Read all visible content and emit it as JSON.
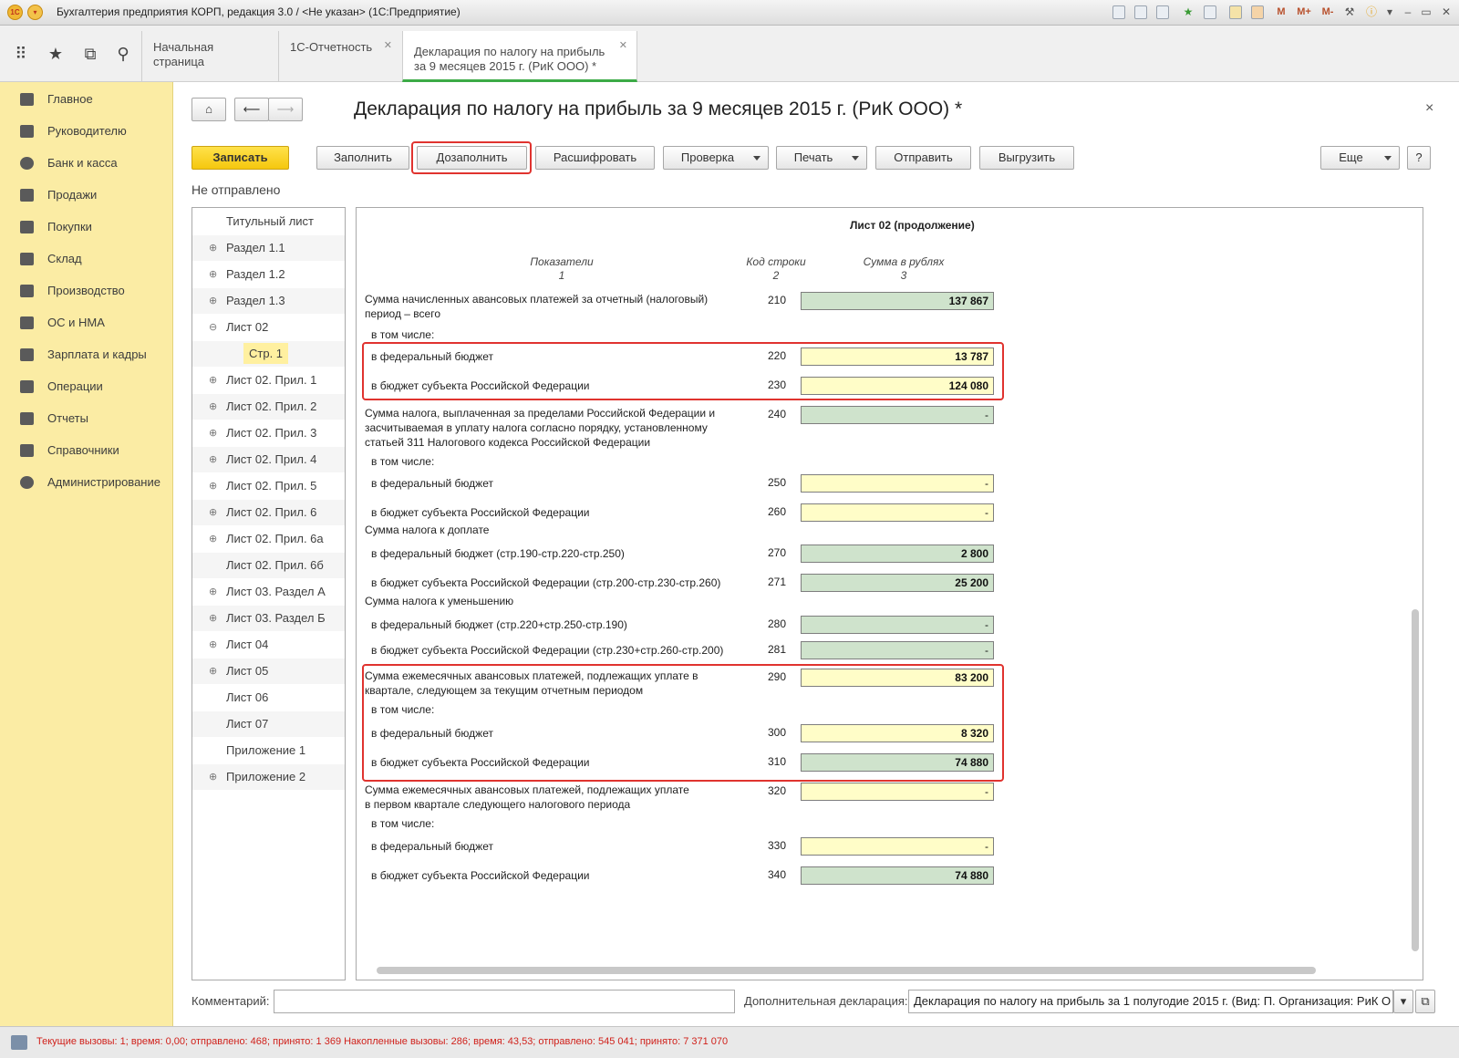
{
  "window": {
    "title": "Бухгалтерия предприятия КОРП, редакция 3.0 / <Не указан>  (1С:Предприятие)",
    "right_buttons": [
      "M",
      "M+",
      "M-"
    ]
  },
  "tabs": [
    {
      "label": "Начальная страница"
    },
    {
      "label": "1С-Отчетность"
    },
    {
      "label_line1": "Декларация по налогу на прибыль",
      "label_line2": "за 9 месяцев 2015 г.  (РиК ООО) *"
    }
  ],
  "sidebar": {
    "items": [
      {
        "label": "Главное",
        "icon": "menu-icon"
      },
      {
        "label": "Руководителю",
        "icon": "trend-icon"
      },
      {
        "label": "Банк и касса",
        "icon": "ruble-icon"
      },
      {
        "label": "Продажи",
        "icon": "bag-icon"
      },
      {
        "label": "Покупки",
        "icon": "cart-icon"
      },
      {
        "label": "Склад",
        "icon": "warehouse-icon"
      },
      {
        "label": "Производство",
        "icon": "factory-icon"
      },
      {
        "label": "ОС и НМА",
        "icon": "truck-icon"
      },
      {
        "label": "Зарплата и кадры",
        "icon": "people-icon"
      },
      {
        "label": "Операции",
        "icon": "scales-icon"
      },
      {
        "label": "Отчеты",
        "icon": "chart-icon"
      },
      {
        "label": "Справочники",
        "icon": "book-icon"
      },
      {
        "label": "Администрирование",
        "icon": "gear-icon"
      }
    ]
  },
  "header": {
    "title": "Декларация по налогу на прибыль за 9 месяцев 2015 г. (РиК ООО) *",
    "close": "×"
  },
  "toolbar": {
    "save": "Записать",
    "fill": "Заполнить",
    "refill": "Дозаполнить",
    "decode": "Расшифровать",
    "check": "Проверка",
    "print": "Печать",
    "send": "Отправить",
    "export": "Выгрузить",
    "more": "Еще",
    "help": "?"
  },
  "status": "Не отправлено",
  "tree": [
    {
      "label": "Титульный лист",
      "toggle": ""
    },
    {
      "label": "Раздел 1.1",
      "toggle": "⊕"
    },
    {
      "label": "Раздел 1.2",
      "toggle": "⊕"
    },
    {
      "label": "Раздел 1.3",
      "toggle": "⊕"
    },
    {
      "label": "Лист 02",
      "toggle": "⊖"
    },
    {
      "label": "Стр. 1",
      "toggle": "",
      "child": true
    },
    {
      "label": "Лист 02. Прил. 1",
      "toggle": "⊕"
    },
    {
      "label": "Лист 02. Прил. 2",
      "toggle": "⊕"
    },
    {
      "label": "Лист 02. Прил. 3",
      "toggle": "⊕"
    },
    {
      "label": "Лист 02. Прил. 4",
      "toggle": "⊕"
    },
    {
      "label": "Лист 02. Прил. 5",
      "toggle": "⊕"
    },
    {
      "label": "Лист 02. Прил. 6",
      "toggle": "⊕"
    },
    {
      "label": "Лист 02. Прил. 6а",
      "toggle": "⊕"
    },
    {
      "label": "Лист 02. Прил. 6б",
      "toggle": ""
    },
    {
      "label": "Лист 03. Раздел А",
      "toggle": "⊕"
    },
    {
      "label": "Лист 03. Раздел Б",
      "toggle": "⊕"
    },
    {
      "label": "Лист 04",
      "toggle": "⊕"
    },
    {
      "label": "Лист 05",
      "toggle": "⊕"
    },
    {
      "label": "Лист 06",
      "toggle": ""
    },
    {
      "label": "Лист 07",
      "toggle": ""
    },
    {
      "label": "Приложение 1",
      "toggle": ""
    },
    {
      "label": "Приложение 2",
      "toggle": "⊕"
    }
  ],
  "form": {
    "sheet_title": "Лист 02 (продолжение)",
    "col_indicators": "Показатели",
    "col_indicators_num": "1",
    "col_code": "Код строки",
    "col_code_num": "2",
    "col_sum": "Сумма в рублях",
    "col_sum_num": "3",
    "rows": [
      {
        "label": "Сумма начисленных авансовых платежей за отчетный (налоговый)",
        "label2": "период – всего",
        "code": "210",
        "value": "137 867",
        "style": "green"
      },
      {
        "label": "в том числе:"
      },
      {
        "label": "в федеральный бюджет",
        "code": "220",
        "value": "13 787",
        "style": "yellow"
      },
      {
        "label": "в бюджет субъекта Российской Федерации",
        "code": "230",
        "value": "124 080",
        "style": "yellow"
      },
      {
        "label": "Сумма налога, выплаченная за пределами Российской Федерации и",
        "label2": "засчитываемая в уплату налога согласно порядку, установленному",
        "label3": "статьей 311 Налогового кодекса Российской Федерации",
        "code": "240",
        "value": "-",
        "style": "green"
      },
      {
        "label": "в том числе:"
      },
      {
        "label": "в федеральный бюджет",
        "code": "250",
        "value": "-",
        "style": "yellow"
      },
      {
        "label": "в бюджет субъекта Российской Федерации",
        "code": "260",
        "value": "-",
        "style": "yellow"
      },
      {
        "label": "Сумма налога к доплате"
      },
      {
        "label": "в федеральный бюджет (стр.190-стр.220-стр.250)",
        "code": "270",
        "value": "2 800",
        "style": "green"
      },
      {
        "label": "в бюджет субъекта Российской Федерации (стр.200-стр.230-стр.260)",
        "code": "271",
        "value": "25 200",
        "style": "green"
      },
      {
        "label": "Сумма налога к уменьшению"
      },
      {
        "label": "в федеральный бюджет (стр.220+стр.250-стр.190)",
        "code": "280",
        "value": "-",
        "style": "green"
      },
      {
        "label": "в бюджет субъекта Российской Федерации (стр.230+стр.260-стр.200)",
        "code": "281",
        "value": "-",
        "style": "green"
      },
      {
        "label": "Сумма ежемесячных авансовых платежей, подлежащих уплате в",
        "label2": "квартале, следующем за текущим отчетным периодом",
        "code": "290",
        "value": "83 200",
        "style": "yellow"
      },
      {
        "label": "в том числе:"
      },
      {
        "label": "в федеральный бюджет",
        "code": "300",
        "value": "8 320",
        "style": "yellow"
      },
      {
        "label": "в бюджет субъекта Российской Федерации",
        "code": "310",
        "value": "74 880",
        "style": "green"
      },
      {
        "label": "Сумма ежемесячных авансовых платежей, подлежащих уплате",
        "label2": "в первом квартале следующего налогового периода",
        "code": "320",
        "value": "-",
        "style": "yellow"
      },
      {
        "label": "в том числе:"
      },
      {
        "label": "в федеральный бюджет",
        "code": "330",
        "value": "-",
        "style": "yellow"
      },
      {
        "label": "в бюджет субъекта Российской Федерации",
        "code": "340",
        "value": "74 880",
        "style": "green"
      }
    ]
  },
  "bottom": {
    "comment_label": "Комментарий:",
    "comment_value": "",
    "extra_label": "Дополнительная декларация:",
    "extra_value": "Декларация по налогу на прибыль за 1 полугодие 2015 г. (Вид: П. Организация: РиК О"
  },
  "statusbar": {
    "text": "Текущие вызовы: 1; время: 0,00; отправлено: 468; принято: 1 369   Накопленные вызовы: 286; время: 43,53; отправлено: 545 041; принято: 7 371 070"
  }
}
